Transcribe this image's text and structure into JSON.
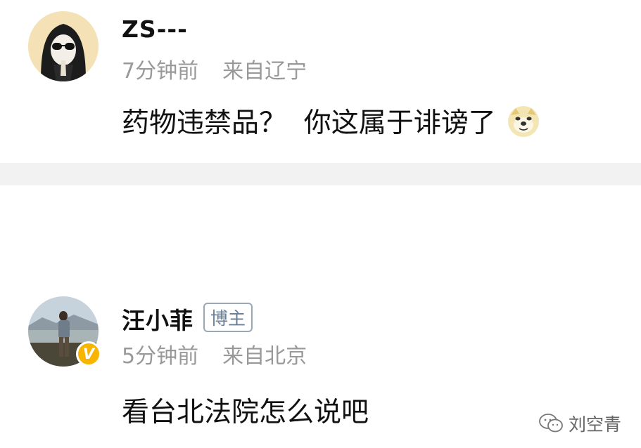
{
  "comments": [
    {
      "username": "ZS---",
      "time": "7分钟前",
      "location": "来自辽宁",
      "text": "药物违禁品？  你这属于诽谤了",
      "emoji": "doge-emoji"
    },
    {
      "username": "汪小菲",
      "badge": "博主",
      "time": "5分钟前",
      "location": "来自北京",
      "text": "看台北法院怎么说吧",
      "verified_mark": "V"
    }
  ],
  "watermark": {
    "label": "刘空青",
    "icon": "wechat-icon"
  },
  "colors": {
    "meta_gray": "#999999",
    "badge_blue": "#6a7f96",
    "verified_gold": "#f7b500",
    "divider": "#f2f2f2"
  }
}
